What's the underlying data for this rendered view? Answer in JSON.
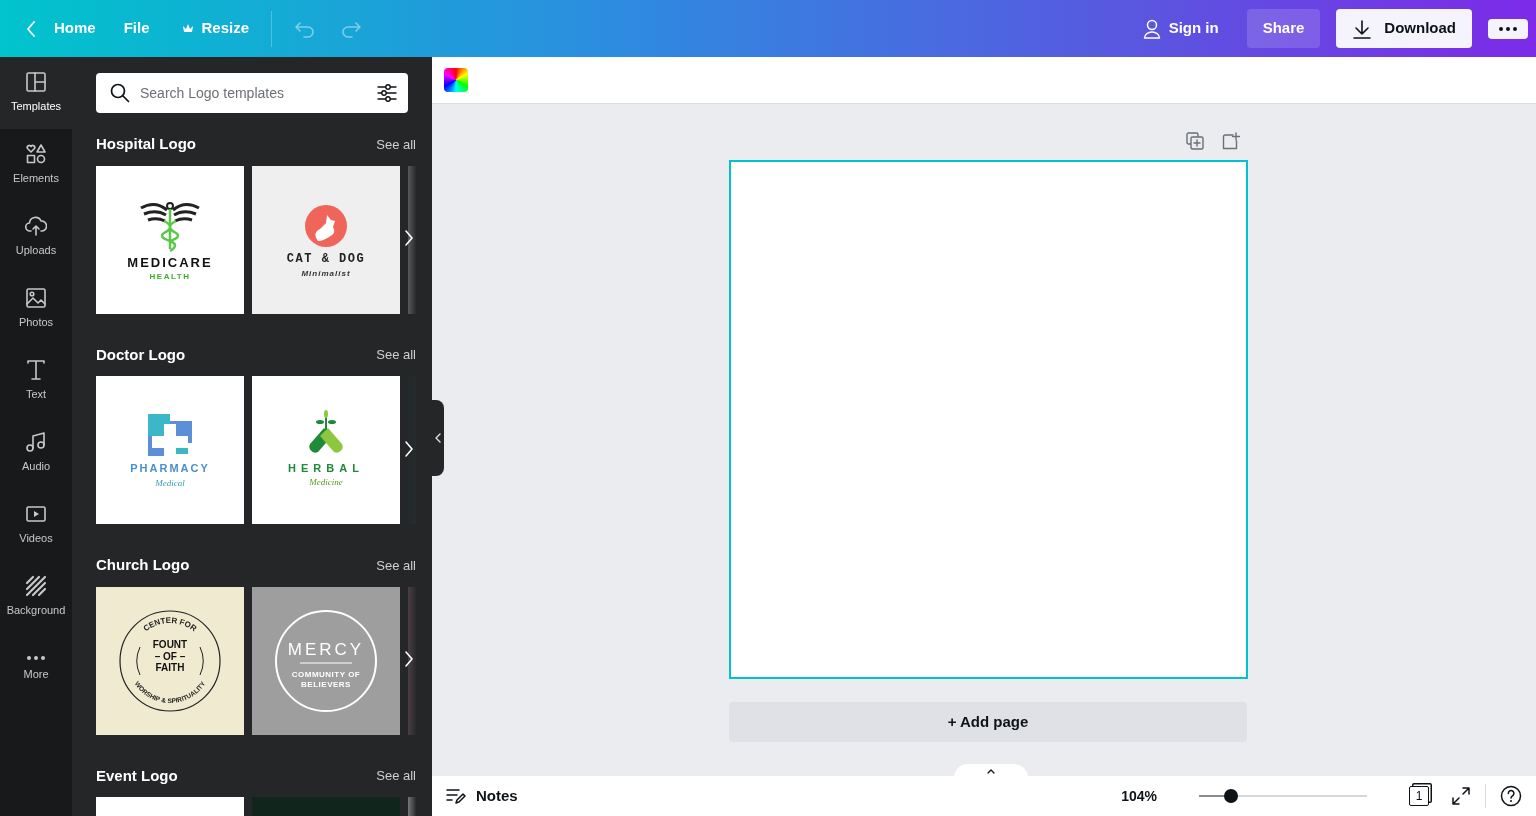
{
  "topbar": {
    "home": "Home",
    "file": "File",
    "resize": "Resize",
    "sign_in": "Sign in",
    "share": "Share",
    "download": "Download"
  },
  "sidebar": {
    "items": [
      {
        "label": "Templates",
        "selected": true
      },
      {
        "label": "Elements",
        "selected": false
      },
      {
        "label": "Uploads",
        "selected": false
      },
      {
        "label": "Photos",
        "selected": false
      },
      {
        "label": "Text",
        "selected": false
      },
      {
        "label": "Audio",
        "selected": false
      },
      {
        "label": "Videos",
        "selected": false
      },
      {
        "label": "Background",
        "selected": false
      },
      {
        "label": "More",
        "selected": false
      }
    ]
  },
  "panel": {
    "search": {
      "placeholder": "Search Logo templates"
    },
    "sections": [
      {
        "title": "Hospital Logo",
        "see_all": "See all",
        "has_next": true,
        "templates": [
          {
            "kind": "medicare",
            "texts": [
              "MEDICARE",
              "HEALTH"
            ]
          },
          {
            "kind": "catdog",
            "texts": [
              "CAT & DOG",
              "Minimalist"
            ]
          },
          {
            "kind": "peek",
            "color": "#5a5a5a"
          }
        ]
      },
      {
        "title": "Doctor Logo",
        "see_all": "See all",
        "has_next": true,
        "templates": [
          {
            "kind": "pharmacy",
            "texts": [
              "PHARMACY",
              "Medical"
            ]
          },
          {
            "kind": "herbal",
            "texts": [
              "HERBAL",
              "Medicine"
            ]
          },
          {
            "kind": "peek",
            "color": "#1f2a2e"
          }
        ]
      },
      {
        "title": "Church Logo",
        "see_all": "See all",
        "has_next": true,
        "templates": [
          {
            "kind": "fount",
            "texts": [
              "CENTER FOR",
              "FOUNT",
              "– OF –",
              "FAITH",
              "WORSHIP & SPIRITUALITY"
            ]
          },
          {
            "kind": "mercy",
            "texts": [
              "MERCY",
              "COMMUNITY OF",
              "BELIEVERS"
            ]
          },
          {
            "kind": "peek",
            "color": "#4a3e42"
          }
        ]
      },
      {
        "title": "Event Logo",
        "see_all": "See all",
        "templates": [
          {
            "kind": "blank",
            "color": "#ffffff"
          },
          {
            "kind": "blank",
            "color": "#10261c"
          },
          {
            "kind": "peek",
            "color": "#777777"
          }
        ]
      }
    ]
  },
  "canvas": {
    "add_page": "+ Add page"
  },
  "bottom_bar": {
    "notes": "Notes",
    "zoom": {
      "reading": "104%",
      "level": 0.19
    },
    "page_count": "1"
  }
}
